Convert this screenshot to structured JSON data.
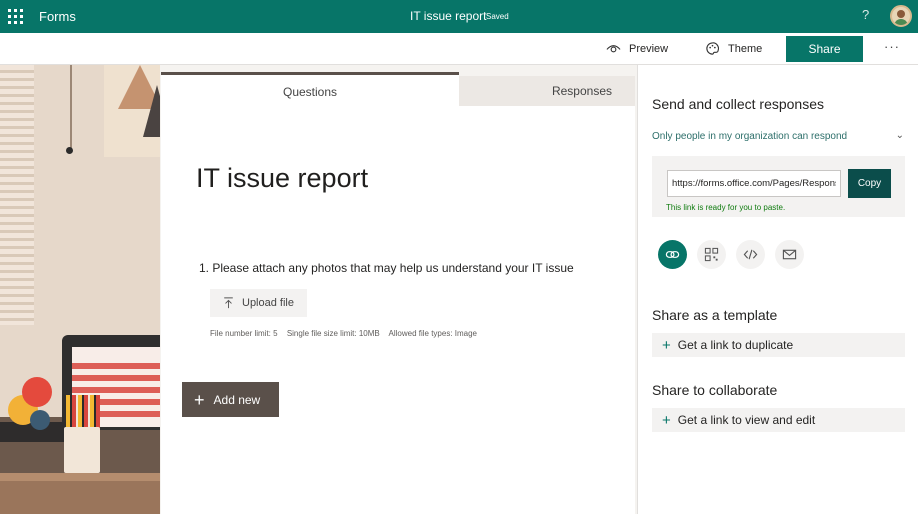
{
  "topbar": {
    "app_name": "Forms",
    "doc_title": "IT issue report",
    "status": "Saved",
    "help": "?"
  },
  "cmdbar": {
    "preview": "Preview",
    "theme": "Theme",
    "share": "Share",
    "more": "···"
  },
  "form": {
    "tabs": {
      "questions": "Questions",
      "responses": "Responses"
    },
    "title": "IT issue report",
    "question": "1. Please attach any photos that may help us understand your IT issue",
    "upload_label": "Upload file",
    "limits": {
      "count": "File number limit: 5",
      "size": "Single file size limit: 10MB",
      "types": "Allowed file types: Image"
    },
    "add_new": "Add new"
  },
  "panel": {
    "send_heading": "Send and collect responses",
    "audience": "Only people in my organization can respond",
    "link_value": "https://forms.office.com/Pages/ResponsePage.aspx",
    "copy_label": "Copy",
    "link_ready": "This link is ready for you to paste.",
    "share_icons": [
      "link-icon",
      "qr-code-icon",
      "embed-icon",
      "email-icon"
    ],
    "template_heading": "Share as a template",
    "template_action": "Get a link to duplicate",
    "collab_heading": "Share to collaborate",
    "collab_action": "Get a link to view and edit"
  },
  "colors": {
    "brand": "#077568",
    "copy": "#0b4d4b",
    "add_new": "#5a504a"
  }
}
